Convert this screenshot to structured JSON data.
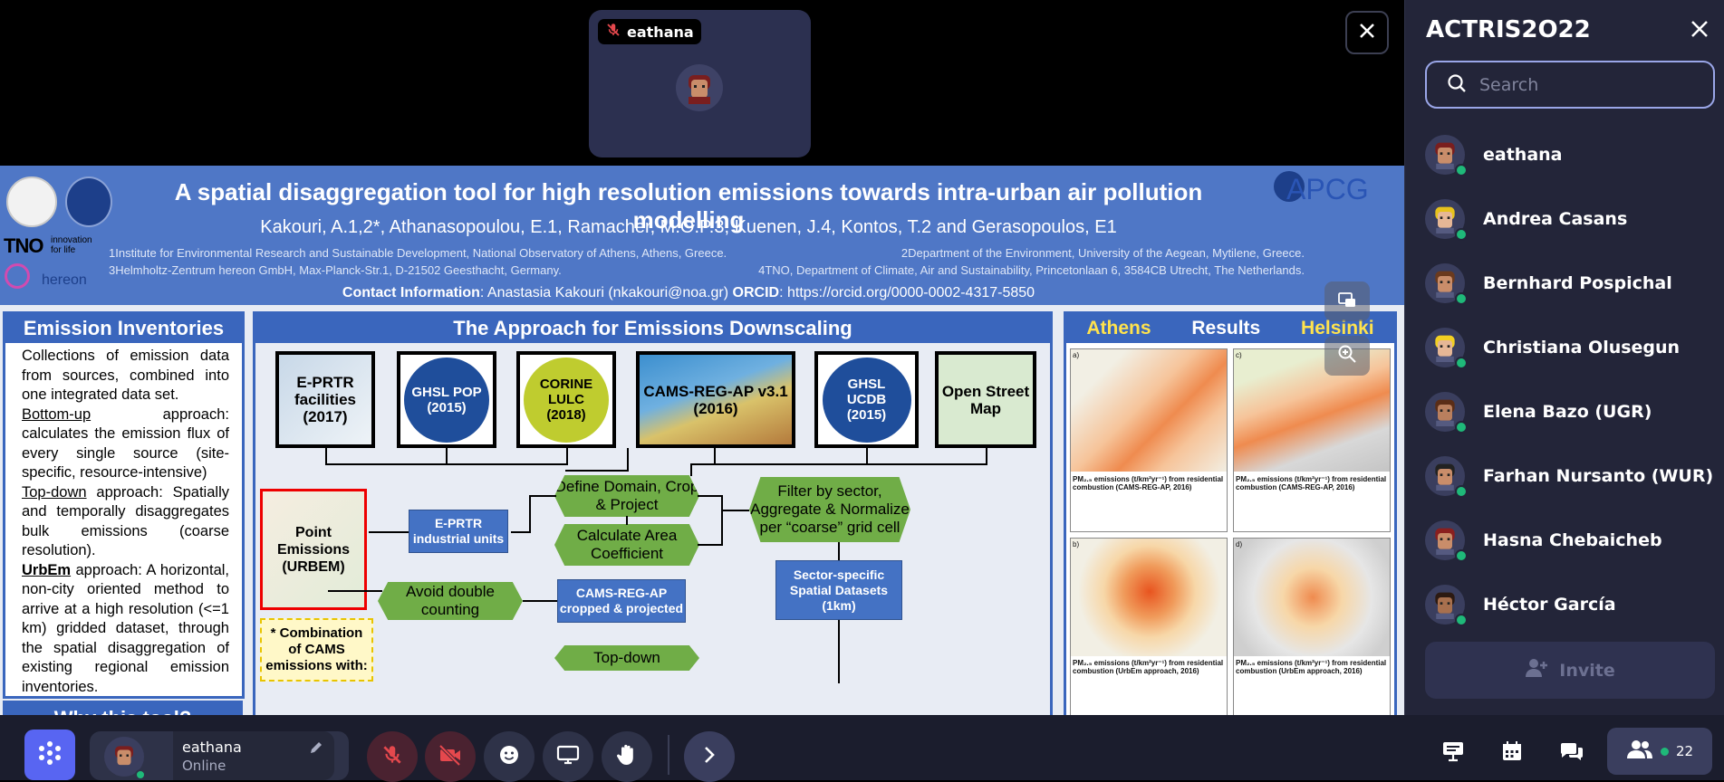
{
  "stage": {
    "tile_name": "eathana",
    "close_icon": "close-icon"
  },
  "poster": {
    "title": "A spatial disaggregation tool for high resolution emissions towards intra-urban air pollution modelling",
    "authors": "Kakouri, A.1,2*, Athanasopoulou, E.1, Ramacher, M.O.P.3, Kuenen, J.4, Kontos, T.2 and Gerasopoulos, E1",
    "aff1_left": "1Institute for Environmental Research and Sustainable Development, National Observatory of Athens, Athens, Greece.",
    "aff1_right": "2Department of the Environment, University of the Aegean, Mytilene, Greece.",
    "aff2_left": "3Helmholtz-Zentrum hereon GmbH, Max-Planck-Str.1, D-21502 Geesthacht, Germany.",
    "aff2_right": "4TNO, Department of Climate, Air and Sustainability, Princetonlaan 6, 3584CB Utrecht, The Netherlands.",
    "contact_label": "Contact Information",
    "contact_text": ": Anastasia Kakouri (nkakouri@noa.gr) ",
    "orcid_label": "ORCID",
    "orcid_text": ": https://orcid.org/0000-0002-4317-5850",
    "logos": {
      "apcg": "APCG",
      "tno": "TNO",
      "tno_sub1": "innovation",
      "tno_sub2": "for life",
      "hereon": "hereon"
    },
    "emission": {
      "header": "Emission Inventories",
      "p1": "Collections of emission data from sources, combined into one integrated data set.",
      "bottom_label": "Bottom-up",
      "bottom_text": " approach: calculates the emission flux of every single source (site-specific, resource-intensive)",
      "top_label": "Top-down",
      "top_text": " approach: Spatially and temporally disaggregates bulk emissions (coarse resolution).",
      "urbem_label": "UrbEm",
      "urbem_text": " approach: A horizontal, non-city oriented method to arrive at a high resolution (<=1 km) gridded dataset, through the spatial disaggregation of existing regional emission inventories.",
      "why": "Why this tool?"
    },
    "approach": {
      "header": "The Approach for Emissions Downscaling",
      "src1": "E-PRTR facilities (2017)",
      "src2": "GHSL POP (2015)",
      "src3": "CORINE LULC (2018)",
      "src4": "CAMS-REG-AP v3.1 (2016)",
      "src5": "GHSL UCDB (2015)",
      "src6": "Open Street Map",
      "define": "Define Domain, Crop & Project",
      "calc": "Calculate Area Coefficient",
      "avoid": "Avoid double counting",
      "filter": "Filter by sector, Aggregate & Normalize per “coarse” grid cell",
      "eprtr_units": "E-PRTR industrial units",
      "cams_crop": "CAMS-REG-AP cropped & projected",
      "sector": "Sector-specific Spatial Datasets (1km)",
      "point": "Point Emissions (URBEM)",
      "combo": "* Combination of CAMS emissions with:",
      "topdown": "Top-down"
    },
    "results": {
      "athens": "Athens",
      "header": "Results",
      "helsinki": "Helsinki",
      "cap_a": "PM₂.₅ emissions (t/km²yr⁻¹) from residential combustion (CAMS-REG-AP, 2016)",
      "cap_c": "PM₂.₅ emissions (t/km²yr⁻¹) from residential combustion (CAMS-REG-AP, 2016)",
      "cap_b": "PM₂.₅ emissions (t/km²yr⁻¹) from residential combustion (UrbEm approach, 2016)",
      "cap_d": "PM₂.₅ emissions (t/km²yr⁻¹) from residential combustion (UrbEm approach, 2016)",
      "label_a": "a)",
      "label_b": "b)",
      "label_c": "c)",
      "label_d": "d)"
    }
  },
  "sidebar": {
    "title": "ACTRIS2O22",
    "search_placeholder": "Search",
    "members": [
      {
        "name": "eathana",
        "hair": "#7a1e1e",
        "skin": "#c98d6a"
      },
      {
        "name": "Andrea Casans",
        "hair": "#e7c21c",
        "skin": "#e6b796"
      },
      {
        "name": "Bernhard Pospichal",
        "hair": "#6b3a1e",
        "skin": "#c98d6a"
      },
      {
        "name": "Christiana Olusegun",
        "hair": "#f2cf22",
        "skin": "#e6b796"
      },
      {
        "name": "Elena Bazo (UGR)",
        "hair": "#5a2d17",
        "skin": "#b97f5e"
      },
      {
        "name": "Farhan Nursanto (WUR)",
        "hair": "#222",
        "skin": "#c98d6a"
      },
      {
        "name": "Hasna Chebaicheb",
        "hair": "#8a1f1f",
        "skin": "#c98d6a"
      },
      {
        "name": "Héctor García",
        "hair": "#2c1a12",
        "skin": "#a8704e"
      }
    ],
    "invite_label": "Invite"
  },
  "bottombar": {
    "user_name": "eathana",
    "user_status": "Online",
    "participants_count": "22"
  },
  "colors": {
    "accent": "#5865f2",
    "danger": "#e5484d",
    "online": "#1fb979",
    "poster_blue": "#3a66bd",
    "flow_green": "#70ad47"
  }
}
